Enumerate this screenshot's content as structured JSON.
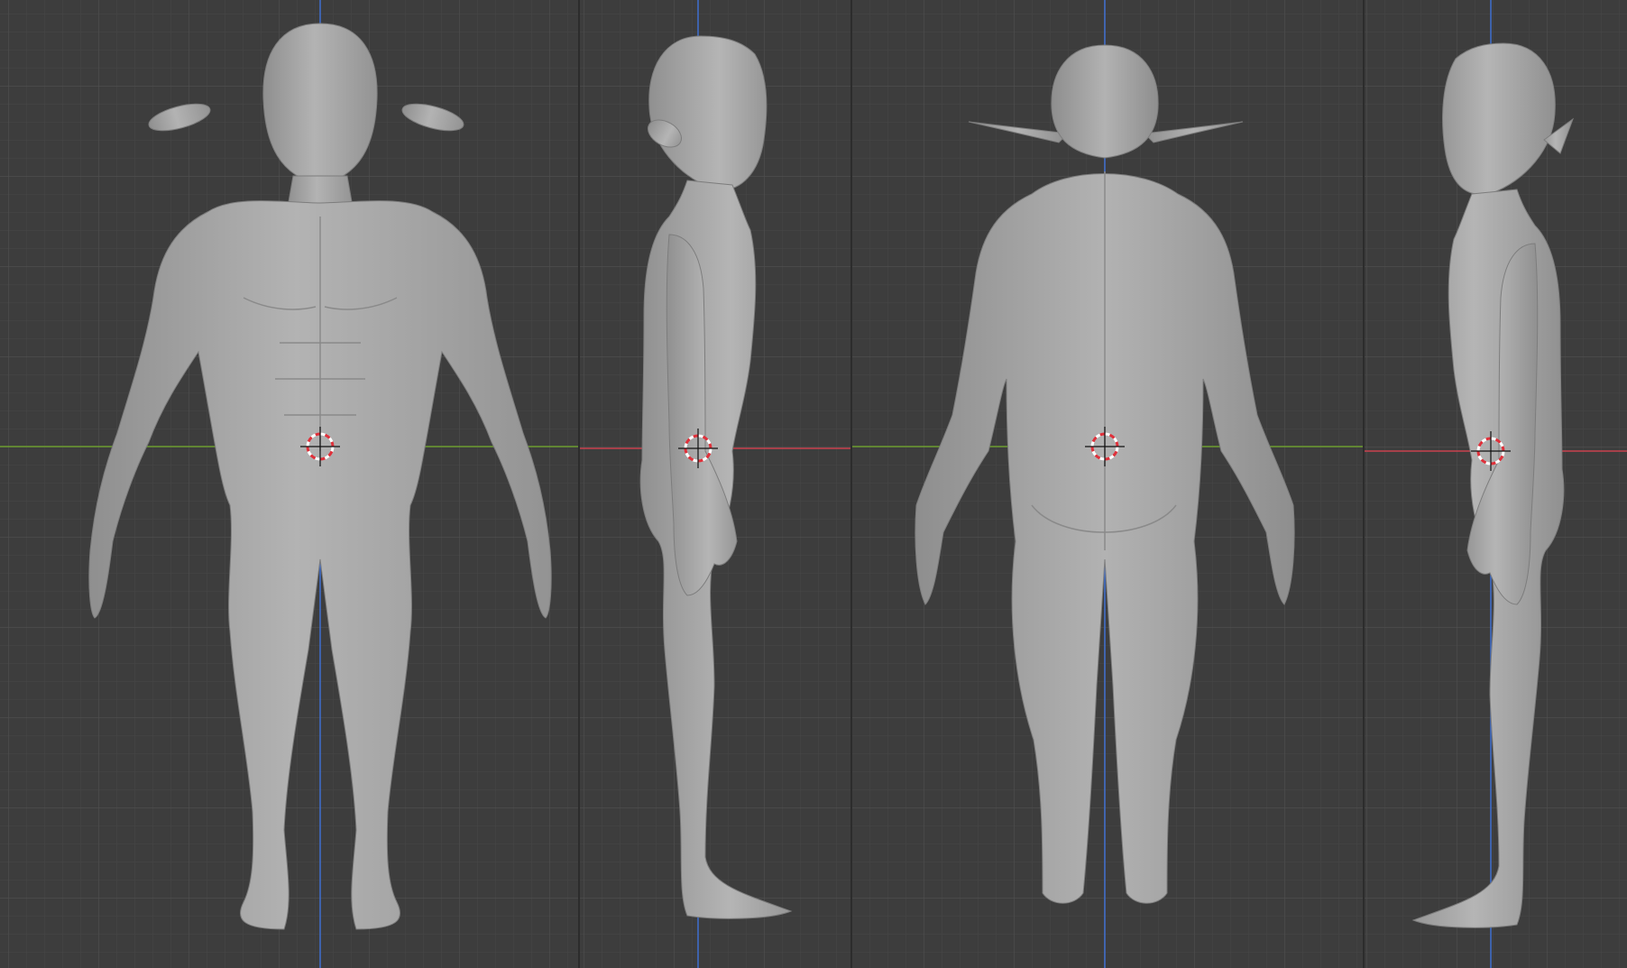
{
  "colors": {
    "viewport_bg": "#3d3d3d",
    "grid_minor": "#474747",
    "grid_major": "#4f4f4f",
    "axis_x_red": "#c9424f",
    "axis_y_green": "#6c9c2f",
    "axis_z_blue": "#3f6fd0",
    "mesh_fill": "#a9a9a9",
    "mesh_shade": "#8f8f8f",
    "mesh_highlight": "#c4c4c4",
    "cursor_red": "#e0303a",
    "cursor_white": "#ffffff"
  },
  "viewports": [
    {
      "view": "front",
      "horizontal_axis": "x",
      "icons": [
        "3d-cursor-icon"
      ]
    },
    {
      "view": "right-side",
      "horizontal_axis": "y",
      "icons": [
        "3d-cursor-icon"
      ]
    },
    {
      "view": "back",
      "horizontal_axis": "x",
      "icons": [
        "3d-cursor-icon"
      ]
    },
    {
      "view": "left-side",
      "horizontal_axis": "y",
      "icons": [
        "3d-cursor-icon"
      ]
    }
  ]
}
